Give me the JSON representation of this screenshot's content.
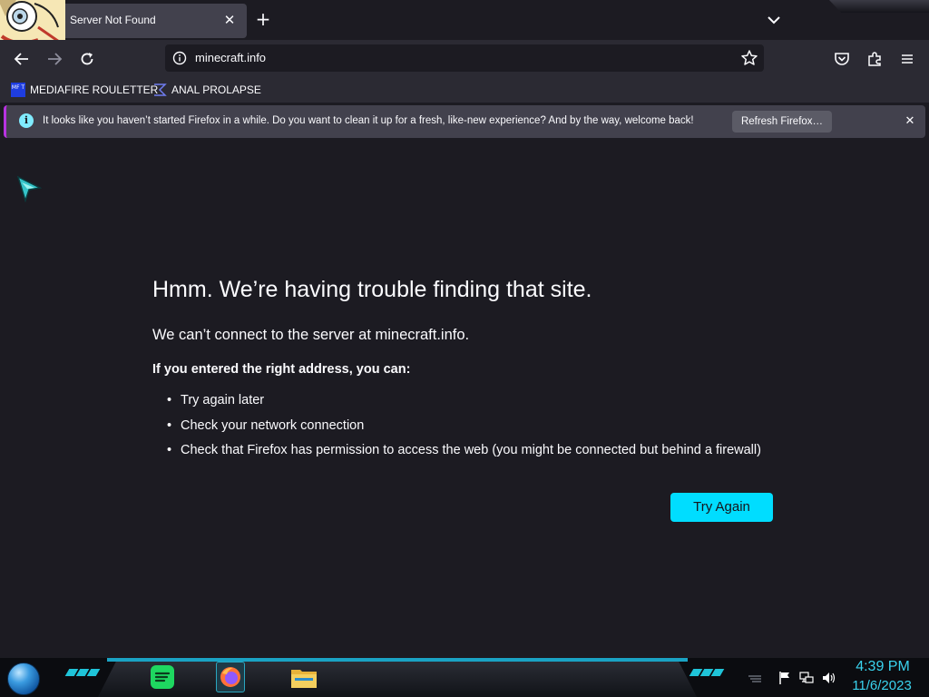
{
  "tab": {
    "title": "Server Not Found"
  },
  "urlbar": {
    "url": "minecraft.info"
  },
  "bookmarks": [
    {
      "label": "MEDIAFIRE ROULETTER",
      "icon": "mediafire-favicon",
      "icon_text": "MF T"
    },
    {
      "label": "ANAL PROLAPSE",
      "icon": "sigma-favicon"
    }
  ],
  "notification": {
    "text": "It looks like you haven’t started Firefox in a while. Do you want to clean it up for a fresh, like-new experience? And by the way, welcome back!",
    "button_label": "Refresh Firefox…"
  },
  "error": {
    "title": "Hmm. We’re having trouble finding that site.",
    "description": "We can’t connect to the server at minecraft.info.",
    "subheading": "If you entered the right address, you can:",
    "suggestions": [
      "Try again later",
      "Check your network connection",
      "Check that Firefox has permission to access the web (you might be connected but behind a firewall)"
    ],
    "button_label": "Try Again"
  },
  "taskbar": {
    "time": "4:39 PM",
    "date": "11/6/2023",
    "apps": [
      "spotify-icon",
      "firefox-icon",
      "file-explorer-icon"
    ]
  },
  "colors": {
    "page_bg": "#1c1b22",
    "toolbar_bg": "#2b2a33",
    "accent": "#00ddff",
    "notification_bar": "#42414d",
    "clock": "#3ad3ee"
  }
}
